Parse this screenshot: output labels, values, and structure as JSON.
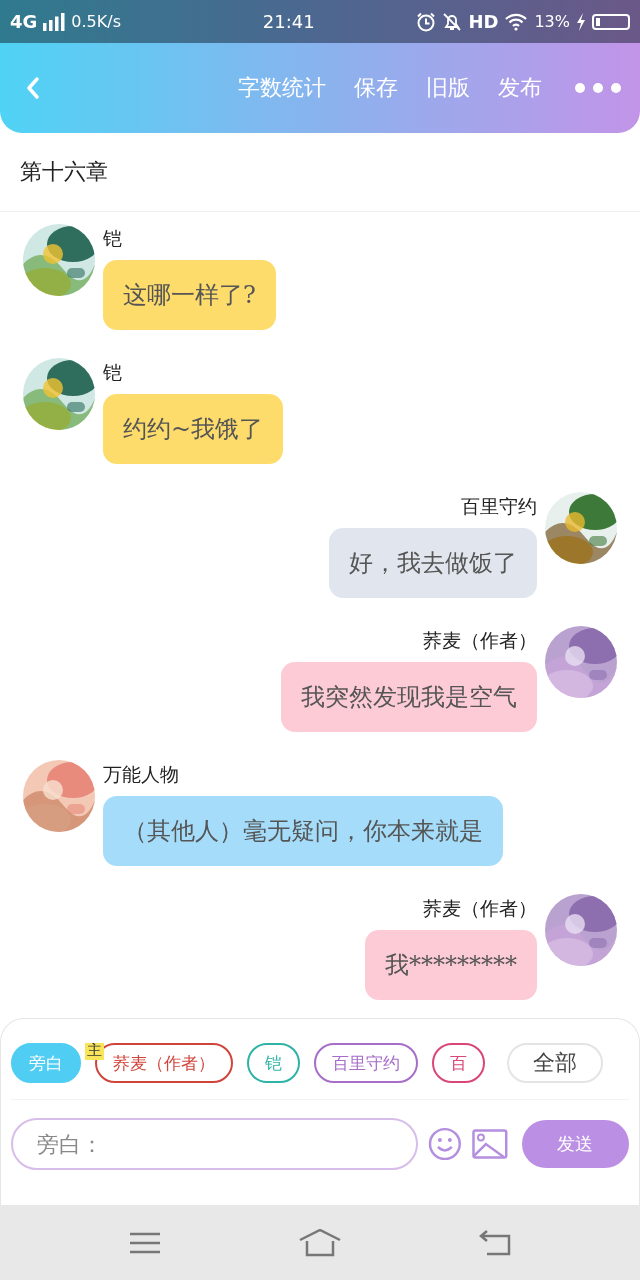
{
  "status_bar": {
    "network": "4G",
    "speed": "0.5K/s",
    "time": "21:41",
    "hd": "HD",
    "battery": "13%"
  },
  "header": {
    "actions": [
      "字数统计",
      "保存",
      "旧版",
      "发布"
    ]
  },
  "chapter": {
    "title": "第十六章"
  },
  "messages": [
    {
      "kind": "left",
      "name": "铠",
      "text": "这哪一样了?",
      "color": "#fddc6c"
    },
    {
      "kind": "left",
      "name": "铠",
      "text": "约约~我饿了",
      "color": "#fddc6c"
    },
    {
      "kind": "right",
      "name": "百里守约",
      "text": "好，我去做饭了",
      "color": "#e1e6ee"
    },
    {
      "kind": "right",
      "name": "荞麦（作者）",
      "text": "我突然发现我是空气",
      "color": "#fccbd6"
    },
    {
      "kind": "left",
      "name": "万能人物",
      "text": "（其他人）毫无疑问，你本来就是",
      "color": "#a4dcfa"
    },
    {
      "kind": "right",
      "name": "荞麦（作者）",
      "text": "我*********",
      "color": "#fccbd6"
    }
  ],
  "characters": [
    {
      "label": "旁白",
      "color": "#4fcdf2",
      "selected": true
    },
    {
      "label": "荞麦（作者）",
      "color": "#d0453b",
      "selected": false,
      "badge": "主"
    },
    {
      "label": "铠",
      "color": "#2eb3a6",
      "selected": false
    },
    {
      "label": "百里守约",
      "color": "#a66dc9",
      "selected": false
    },
    {
      "label": "百",
      "color": "#d9477a",
      "selected": false
    }
  ],
  "all_button": "全部",
  "input": {
    "placeholder": "旁白："
  },
  "send_button": "发送"
}
